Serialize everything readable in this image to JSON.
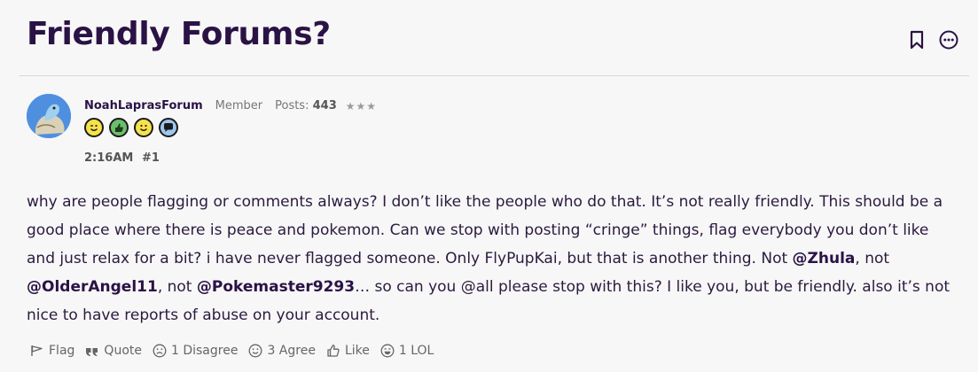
{
  "topic": {
    "title": "Friendly Forums?"
  },
  "header_icons": [
    "bookmark-icon",
    "more-options-icon"
  ],
  "post": {
    "username": "NoahLaprasForum",
    "role": "Member",
    "posts_label": "Posts:",
    "posts_count": "443",
    "stars": "★★★",
    "time": "2:16AM",
    "number": "#1",
    "badges": [
      "wink-badge",
      "thumbs-up-badge",
      "smile-badge",
      "speech-badge"
    ],
    "body": {
      "part1": "why are people flagging or comments always? I don’t like the people who do that. It’s not really friendly. This should be a good place where there is peace and pokemon. Can we stop with posting “cringe” things, flag everybody you don’t like and just relax for a bit? i have never flagged someone. Only FlyPupKai, but that is another thing. Not ",
      "mention1": "@Zhula",
      "part2": ", not ",
      "mention2": "@OlderAngel11",
      "part3": ", not ",
      "mention3": "@Pokemaster9293",
      "part4": "… so can you @all please stop with this? I like you, but be friendly. also it’s not nice to have reports of abuse on your account."
    }
  },
  "actions": {
    "flag": "Flag",
    "quote": "Quote",
    "disagree": "1 Disagree",
    "agree": "3 Agree",
    "like": "Like",
    "lol": "1 LOL"
  },
  "colors": {
    "title": "#2a1245",
    "background": "#f7f7f7",
    "action": "#666666"
  }
}
